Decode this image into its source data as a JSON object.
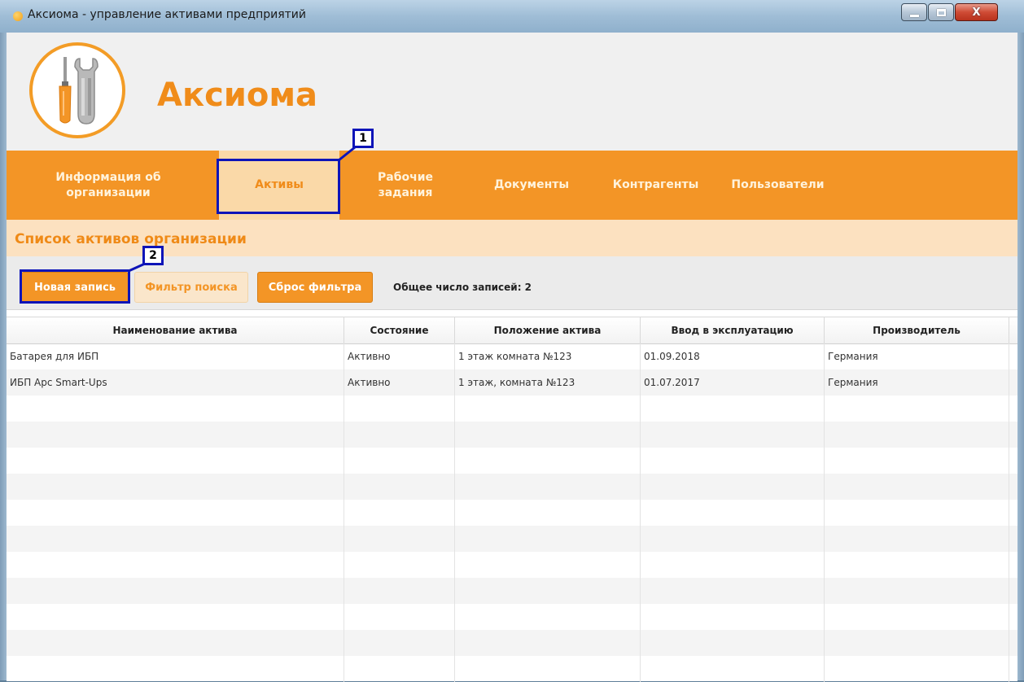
{
  "window": {
    "title": "Аксиома - управление активами предприятий",
    "controls": {
      "minimize": "minimize",
      "maximize": "maximize",
      "close": "X"
    }
  },
  "brand": {
    "name": "Аксиома",
    "logo_icon": "wrench-screwdriver-icon",
    "accent": "#f39526"
  },
  "nav": {
    "items": [
      {
        "label": "Информация об организации",
        "active": false
      },
      {
        "label": "Активы",
        "active": true
      },
      {
        "label": "Рабочие задания",
        "active": false
      },
      {
        "label": "Документы",
        "active": false
      },
      {
        "label": "Контрагенты",
        "active": false
      },
      {
        "label": "Пользователи",
        "active": false
      }
    ]
  },
  "section": {
    "title": "Список активов организации"
  },
  "toolbar": {
    "new_record": "Новая запись",
    "search_filter": "Фильтр поиска",
    "reset_filter": "Сброс фильтра",
    "total_count": "Общее число записей: 2"
  },
  "table": {
    "columns": [
      "Наименование актива",
      "Состояние",
      "Положение актива",
      "Ввод в эксплуатацию",
      "Производитель"
    ],
    "rows": [
      [
        "Батарея для ИБП",
        "Активно",
        "1 этаж комната №123",
        "01.09.2018",
        "Германия"
      ],
      [
        "ИБП Apc Smart-Ups",
        "Активно",
        "1 этаж, комната №123",
        "01.07.2017",
        "Германия"
      ]
    ]
  },
  "annotations": {
    "marker1": "1",
    "marker2": "2",
    "color": "#0d14b8"
  }
}
